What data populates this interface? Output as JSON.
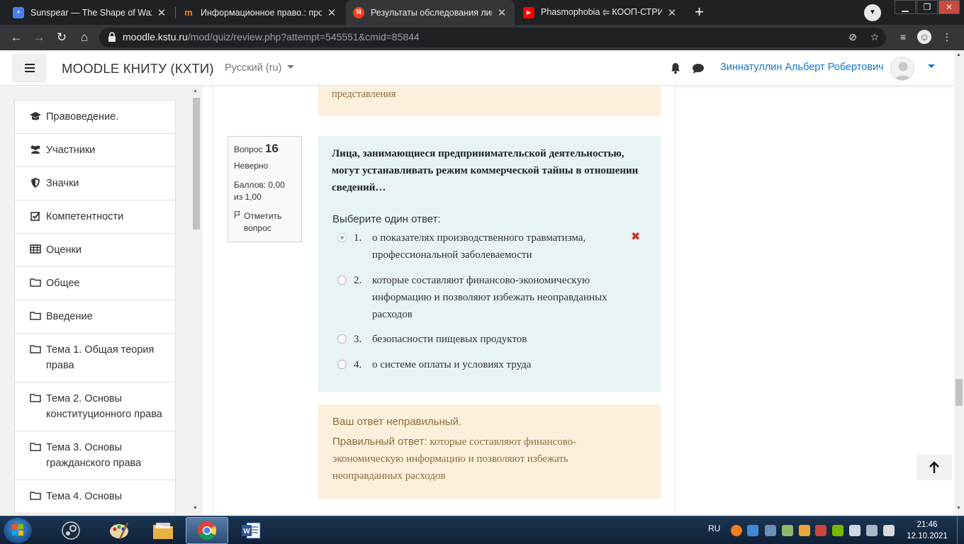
{
  "browser": {
    "tabs": [
      {
        "title": "Sunspear — The Shape of Wax",
        "icon": "chat-app-icon",
        "color": "#4a7ff0"
      },
      {
        "title": "Информационное право.: прос",
        "icon": "moodle-icon",
        "color": "#f98012"
      },
      {
        "title": "Результаты обследования лица,",
        "icon": "yandex-icon",
        "color": "#fc3f1d"
      },
      {
        "title": "Phasmophobia ⥢ КООП-СТРИМ",
        "icon": "youtube-icon",
        "color": "#ff0000"
      }
    ],
    "url_host": "moodle.kstu.ru",
    "url_path": "/mod/quiz/review.php?attempt=545551&cmid=85844"
  },
  "navbar": {
    "site_name": "MOODLE КНИТУ (КХТИ)",
    "language": "Русский (ru)",
    "user_name": "Зиннатуллин Альберт Робертович"
  },
  "sidebar": {
    "items": [
      {
        "label": "Правоведение.",
        "icon": "graduation-cap-icon"
      },
      {
        "label": "Участники",
        "icon": "users-icon"
      },
      {
        "label": "Значки",
        "icon": "shield-icon"
      },
      {
        "label": "Компетентности",
        "icon": "checkbox-icon"
      },
      {
        "label": "Оценки",
        "icon": "table-icon"
      },
      {
        "label": "Общее",
        "icon": "folder-icon"
      },
      {
        "label": "Введение",
        "icon": "folder-icon"
      },
      {
        "label": "Тема 1. Общая теория права",
        "icon": "folder-icon"
      },
      {
        "label": "Тема 2. Основы конституционного права",
        "icon": "folder-icon"
      },
      {
        "label": "Тема 3. Основы гражданского права",
        "icon": "folder-icon"
      },
      {
        "label": "Тема 4. Основы",
        "icon": "folder-icon"
      }
    ]
  },
  "previous_feedback_tail": "представления",
  "question": {
    "label": "Вопрос",
    "number": "16",
    "state": "Неверно",
    "grade": "Баллов: 0,00 из 1,00",
    "flag": "Отметить вопрос",
    "text": "Лица, занимающиеся предпринимательской деятельностью, могут устанавливать режим коммерческой тайны в отношении сведений…",
    "prompt": "Выберите один ответ:",
    "options": [
      {
        "num": "1.",
        "text": "о показателях производственного травматизма, профессиональной заболеваемости",
        "selected": true,
        "incorrect": true
      },
      {
        "num": "2.",
        "text": "которые составляют финансово-экономическую информацию и позволяют избежать неоправданных расходов",
        "selected": false
      },
      {
        "num": "3.",
        "text": "безопасности пищевых продуктов",
        "selected": false
      },
      {
        "num": "4.",
        "text": "о системе оплаты и условиях труда",
        "selected": false
      }
    ]
  },
  "feedback": {
    "status": "Ваш ответ неправильный.",
    "right_label": "Правильный ответ:",
    "right_answer": "которые составляют финансово-экономическую информацию и позволяют избежать неоправданных расходов"
  },
  "taskbar": {
    "lang": "RU",
    "time": "21:46",
    "date": "12.10.2021"
  }
}
